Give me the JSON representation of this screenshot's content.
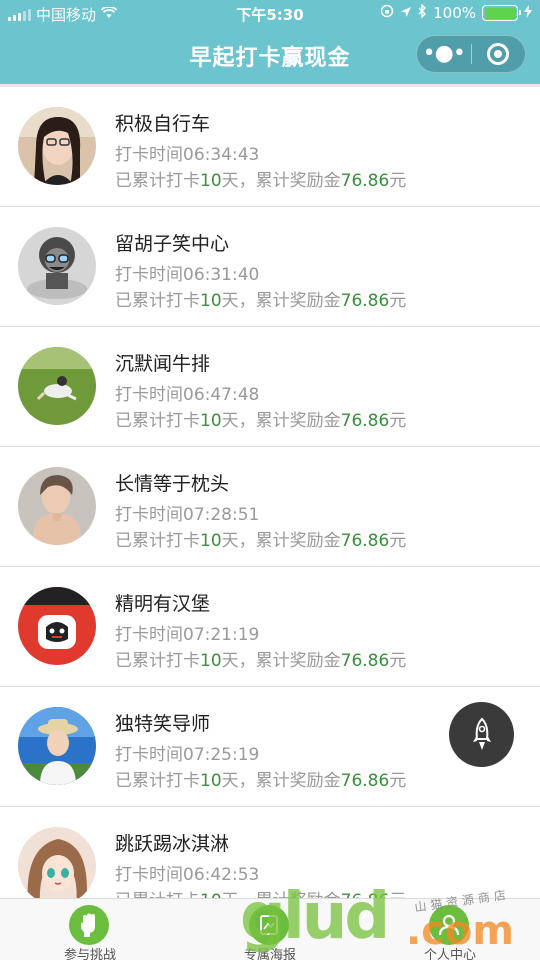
{
  "status_bar": {
    "carrier": "中国移动",
    "time": "下午5:30",
    "battery_text": "100%",
    "battery_level": 1.0
  },
  "nav": {
    "title": "早起打卡赢现金",
    "more_icon": "more-dots-icon",
    "close_icon": "target-circle-icon"
  },
  "list": {
    "time_prefix": "打卡时间",
    "summary_prefix": "已累计打卡",
    "day_unit": "天，累计奖励金",
    "currency_unit": "元",
    "items": [
      {
        "name": "积极自行车",
        "time": "06:34:43",
        "days": "10",
        "reward": "76.86"
      },
      {
        "name": "留胡子笑中心",
        "time": "06:31:40",
        "days": "10",
        "reward": "76.86"
      },
      {
        "name": "沉默闻牛排",
        "time": "06:47:48",
        "days": "10",
        "reward": "76.86"
      },
      {
        "name": "长情等于枕头",
        "time": "07:28:51",
        "days": "10",
        "reward": "76.86"
      },
      {
        "name": "精明有汉堡",
        "time": "07:21:19",
        "days": "10",
        "reward": "76.86"
      },
      {
        "name": "独特笑导师",
        "time": "07:25:19",
        "days": "10",
        "reward": "76.86"
      },
      {
        "name": "跳跃踢冰淇淋",
        "time": "06:42:53",
        "days": "10",
        "reward": "76.86"
      }
    ]
  },
  "fab": {
    "icon": "rocket-icon"
  },
  "tabs": [
    {
      "label": "参与挑战",
      "icon": "fist-icon"
    },
    {
      "label": "专属海报",
      "icon": "poster-icon"
    },
    {
      "label": "个人中心",
      "icon": "person-icon"
    }
  ],
  "watermark": {
    "logo": "glud",
    "domain": ".com",
    "text": "山猫资源商店"
  },
  "colors": {
    "header": "#6cc4cf",
    "highlight": "#3c8f3c",
    "tab_icon": "#5fbf3a"
  }
}
